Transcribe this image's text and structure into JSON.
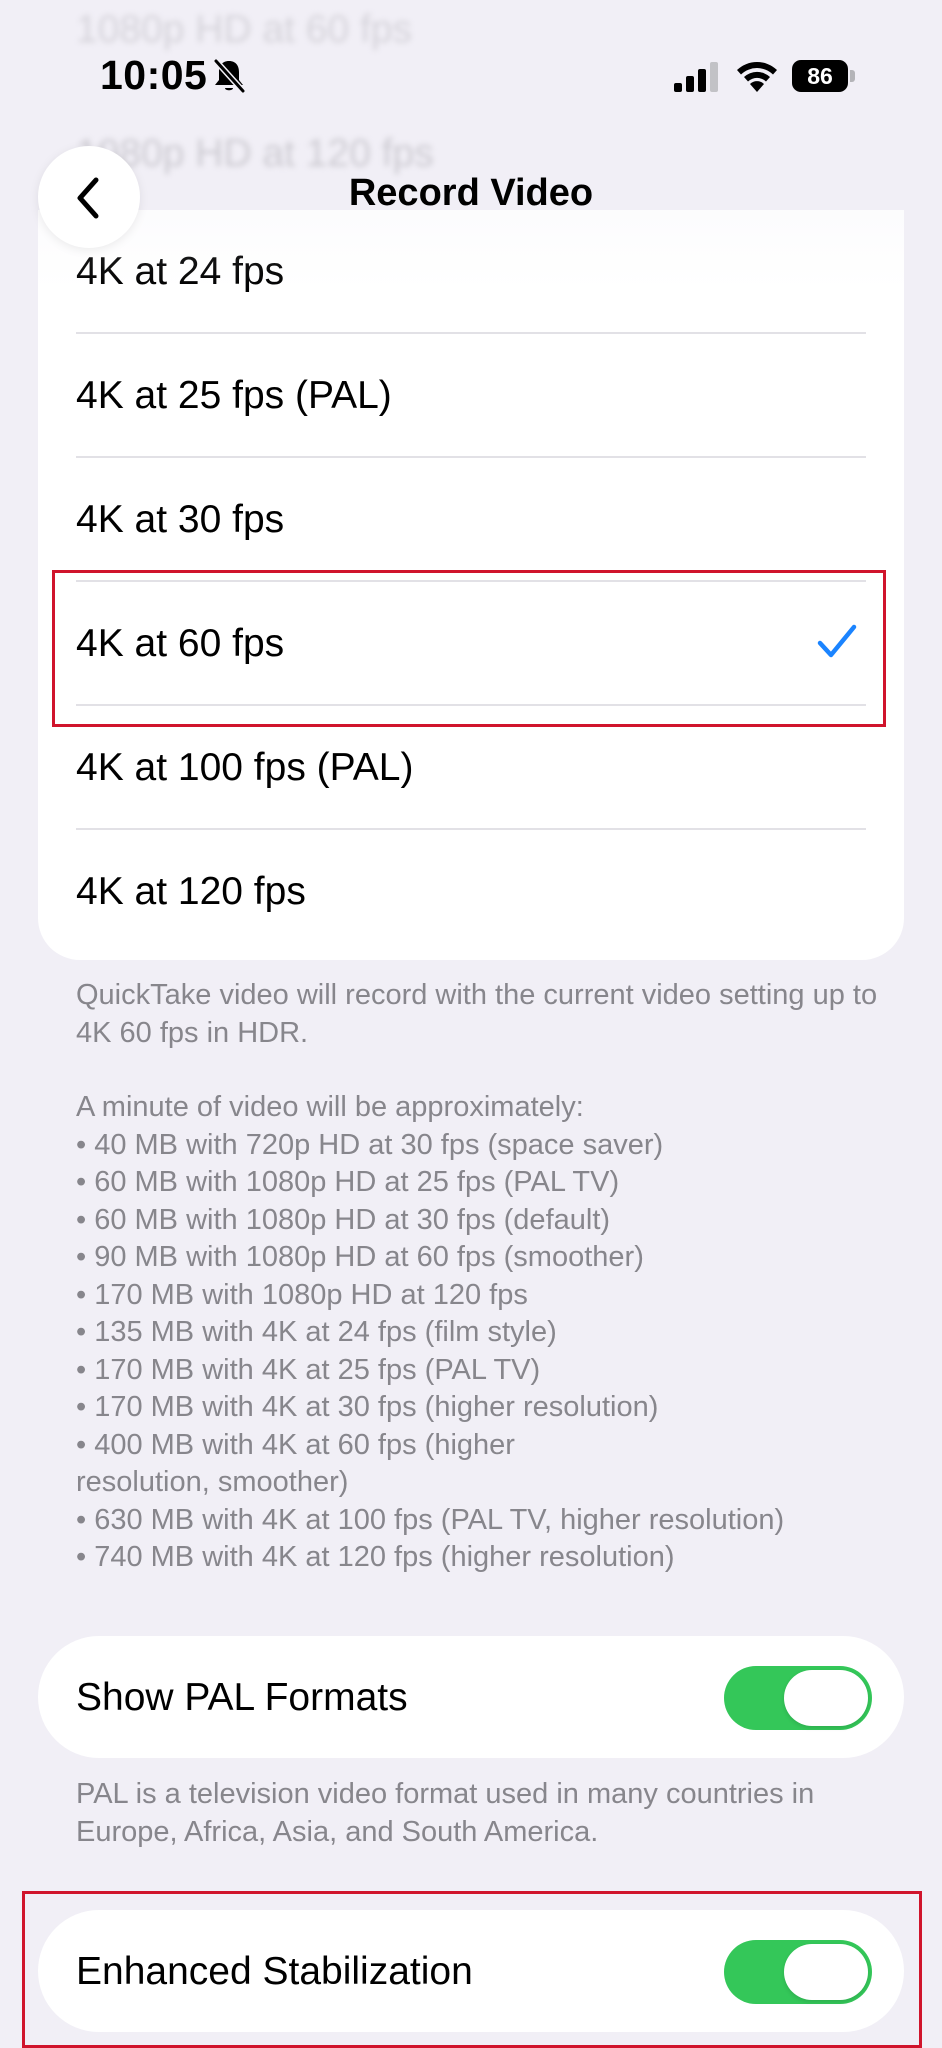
{
  "status_bar": {
    "time": "10:05",
    "battery_level": "86",
    "icons": [
      "bell-slash-icon",
      "cellular-signal-icon",
      "wifi-icon",
      "battery-icon"
    ]
  },
  "background_rows": [
    "1080p HD at 60 fps",
    "1080p HD at 120 fps"
  ],
  "nav": {
    "title": "Record Video",
    "back_icon": "chevron-left-icon"
  },
  "video_formats": [
    {
      "label": "4K at 24 fps",
      "selected": false
    },
    {
      "label": "4K at 25 fps (PAL)",
      "selected": false
    },
    {
      "label": "4K at 30 fps",
      "selected": false
    },
    {
      "label": "4K at 60 fps",
      "selected": true
    },
    {
      "label": "4K at 100 fps (PAL)",
      "selected": false
    },
    {
      "label": "4K at 120 fps",
      "selected": false
    }
  ],
  "quicktake_note": "QuickTake video will record with the current video setting up to 4K 60 fps in HDR.",
  "usage_intro": "A minute of video will be approximately:",
  "usage_items": [
    "• 40 MB with 720p HD at 30 fps (space saver)",
    "• 60 MB with 1080p HD at 25 fps (PAL TV)",
    "• 60 MB with 1080p HD at 30 fps (default)",
    "• 90 MB with 1080p HD at 60 fps (smoother)",
    "• 170 MB with 1080p HD at 120 fps",
    "• 135 MB with 4K at 24 fps (film style)",
    "• 170 MB with 4K at 25 fps (PAL TV)",
    "• 170 MB with 4K at 30 fps (higher resolution)",
    "• 400 MB with 4K at 60 fps (higher resolution, smoother)",
    "• 630 MB with 4K at 100 fps (PAL TV, higher resolution)",
    "• 740 MB with 4K at 120 fps (higher resolution)"
  ],
  "settings": {
    "show_pal": {
      "label": "Show PAL Formats",
      "on": true
    },
    "pal_note": "PAL is a television video format used in many countries in Europe, Africa, Asia, and South America.",
    "enhanced_stabilization": {
      "label": "Enhanced Stabilization",
      "on": true
    }
  },
  "colors": {
    "background": "#f1eff6",
    "card": "#ffffff",
    "accent_blue": "#1b84ff",
    "toggle_on": "#34c759",
    "secondary_text": "#87868c",
    "highlight_red": "#d0142c"
  }
}
